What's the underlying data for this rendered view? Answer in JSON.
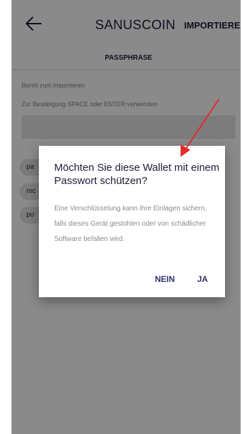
{
  "appbar": {
    "title": "SANUSCOIN",
    "import_label": "IMPORTIEREN"
  },
  "tabs": {
    "passphrase": "PASSPHRASE"
  },
  "content": {
    "status": "Bereit zum Importieren",
    "instruction": "Zur Bestätigung SPACE oder ENTER verwenden",
    "chips": [
      "pa",
      "mc",
      "po"
    ]
  },
  "dialog": {
    "title": "Möchten Sie diese Wallet mit einem Passwort schützen?",
    "body": "Eine Verschlüsselung kann Ihre Einlagen sichern, falls dieses Gerät gestohlen oder von schädlicher Software befallen wird.",
    "no_label": "NEIN",
    "yes_label": "JA"
  },
  "colors": {
    "arrow": "#e32b2b",
    "dialog_button": "#2f3370"
  }
}
